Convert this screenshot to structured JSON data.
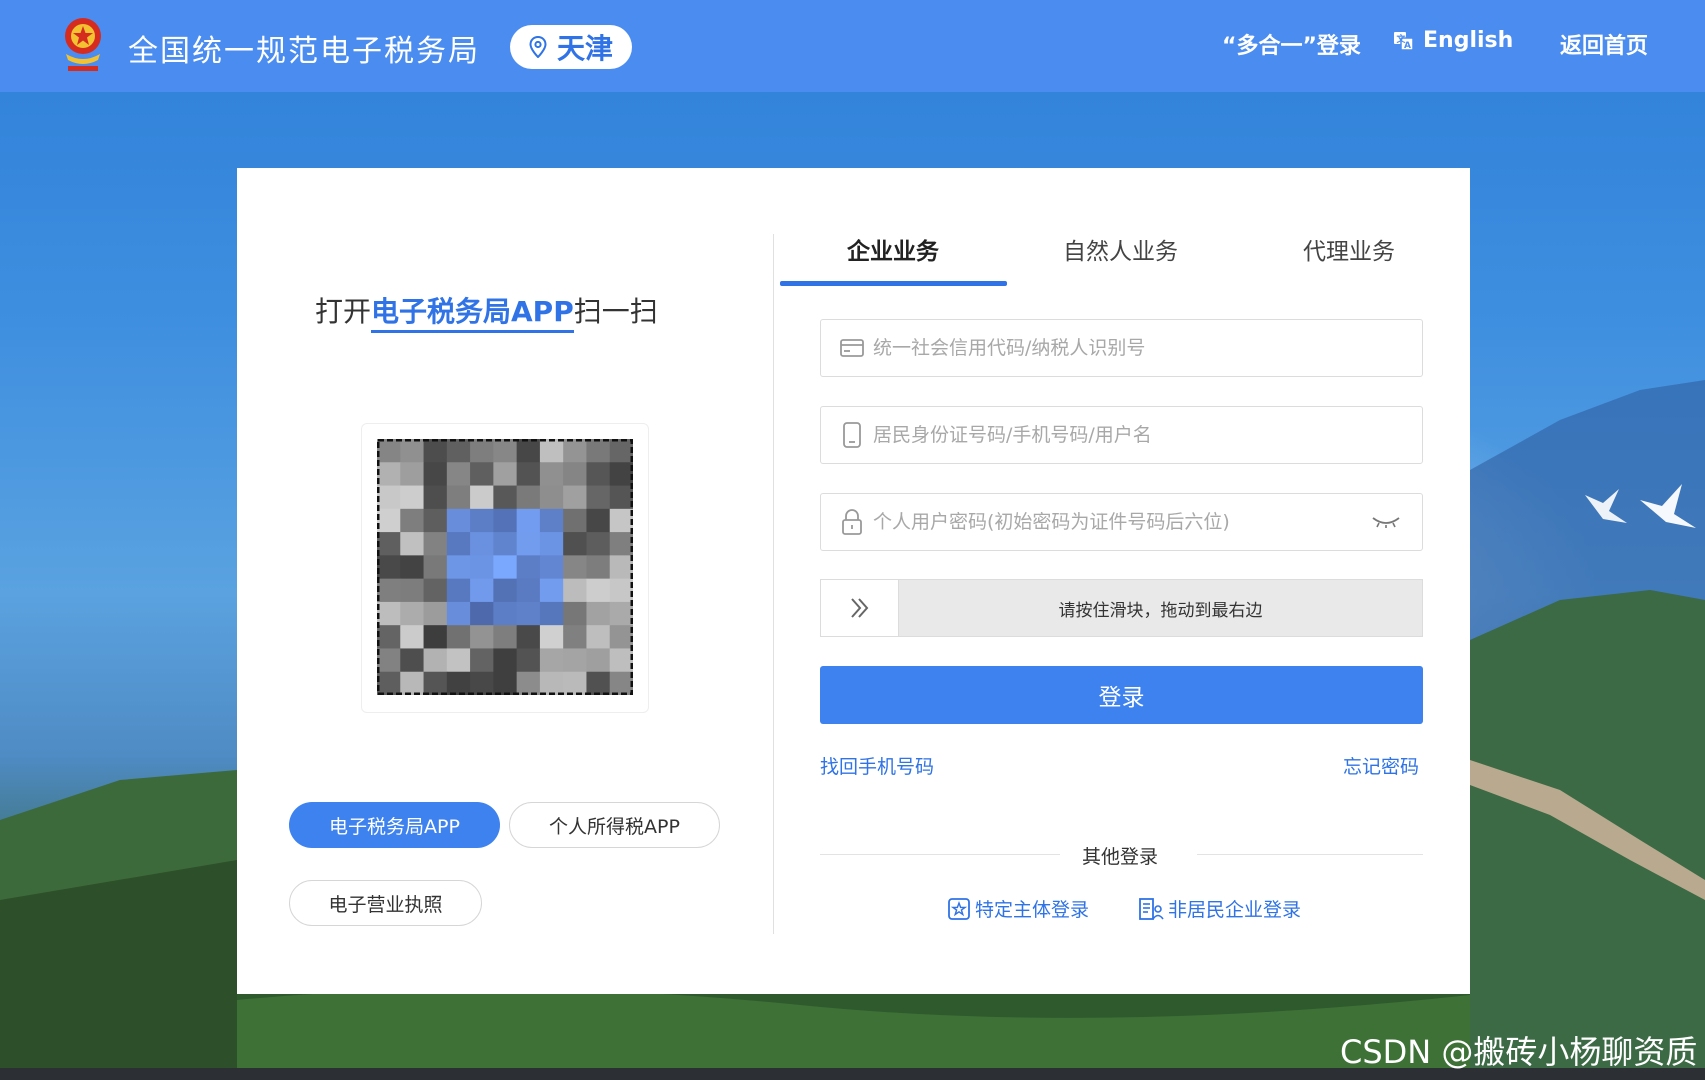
{
  "header": {
    "site_title": "全国统一规范电子税务局",
    "city": "天津",
    "nav": {
      "multi_login": "“多合一”登录",
      "english": "English",
      "home": "返回首页"
    }
  },
  "qr_panel": {
    "title_prefix": "打开",
    "title_highlight": "电子税务局APP",
    "title_suffix": "扫一扫",
    "app_buttons": [
      "电子税务局APP",
      "个人所得税APP",
      "电子营业执照"
    ]
  },
  "login": {
    "tabs": [
      "企业业务",
      "自然人业务",
      "代理业务"
    ],
    "active_tab": "企业业务",
    "fields": {
      "credit_code_placeholder": "统一社会信用代码/纳税人识别号",
      "id_placeholder": "居民身份证号码/手机号码/用户名",
      "password_placeholder": "个人用户密码(初始密码为证件号码后六位)"
    },
    "slider_text": "请按住滑块，拖动到最右边",
    "submit": "登录",
    "recover_phone": "找回手机号码",
    "forgot_password": "忘记密码",
    "other_login_title": "其他登录",
    "other_logins": [
      "特定主体登录",
      "非居民企业登录"
    ]
  },
  "watermark": "CSDN @搬砖小杨聊资质",
  "colors": {
    "header_bg": "#4a8cf0",
    "primary": "#3d82ee",
    "link": "#2f73e6"
  }
}
